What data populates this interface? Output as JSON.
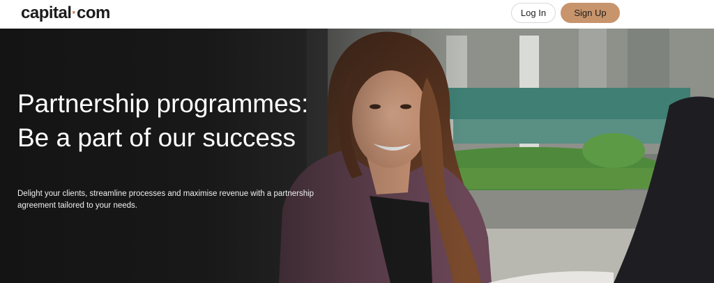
{
  "header": {
    "logo_text": "capital",
    "logo_dot": "·",
    "logo_suffix": "com",
    "login_label": "Log In",
    "signup_label": "Sign Up"
  },
  "hero": {
    "title": "Partnership programmes: Be a part of our success",
    "subtitle": "Delight your clients, streamline processes and maximise revenue with a partnership agreement tailored to your needs."
  },
  "colors": {
    "brand_accent": "#c8946c",
    "logo_dot": "#c28c62",
    "hero_overlay": "#121212"
  }
}
